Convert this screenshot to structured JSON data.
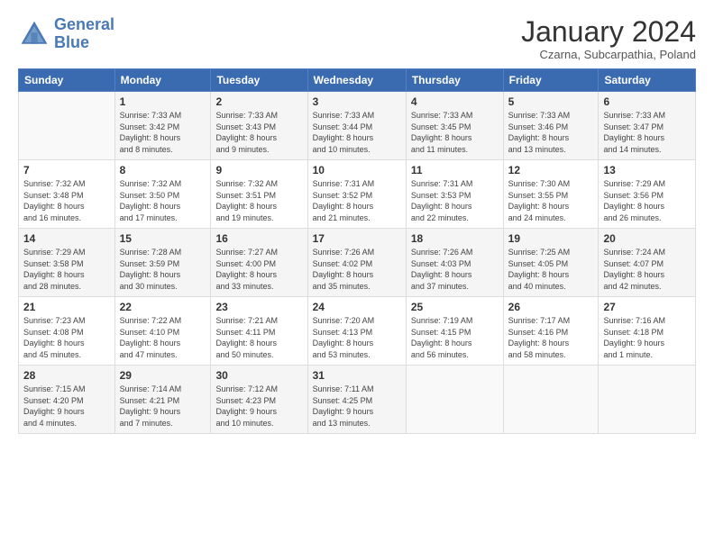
{
  "logo": {
    "line1": "General",
    "line2": "Blue"
  },
  "title": "January 2024",
  "subtitle": "Czarna, Subcarpathia, Poland",
  "days_header": [
    "Sunday",
    "Monday",
    "Tuesday",
    "Wednesday",
    "Thursday",
    "Friday",
    "Saturday"
  ],
  "weeks": [
    [
      {
        "num": "",
        "info": ""
      },
      {
        "num": "1",
        "info": "Sunrise: 7:33 AM\nSunset: 3:42 PM\nDaylight: 8 hours\nand 8 minutes."
      },
      {
        "num": "2",
        "info": "Sunrise: 7:33 AM\nSunset: 3:43 PM\nDaylight: 8 hours\nand 9 minutes."
      },
      {
        "num": "3",
        "info": "Sunrise: 7:33 AM\nSunset: 3:44 PM\nDaylight: 8 hours\nand 10 minutes."
      },
      {
        "num": "4",
        "info": "Sunrise: 7:33 AM\nSunset: 3:45 PM\nDaylight: 8 hours\nand 11 minutes."
      },
      {
        "num": "5",
        "info": "Sunrise: 7:33 AM\nSunset: 3:46 PM\nDaylight: 8 hours\nand 13 minutes."
      },
      {
        "num": "6",
        "info": "Sunrise: 7:33 AM\nSunset: 3:47 PM\nDaylight: 8 hours\nand 14 minutes."
      }
    ],
    [
      {
        "num": "7",
        "info": "Sunrise: 7:32 AM\nSunset: 3:48 PM\nDaylight: 8 hours\nand 16 minutes."
      },
      {
        "num": "8",
        "info": "Sunrise: 7:32 AM\nSunset: 3:50 PM\nDaylight: 8 hours\nand 17 minutes."
      },
      {
        "num": "9",
        "info": "Sunrise: 7:32 AM\nSunset: 3:51 PM\nDaylight: 8 hours\nand 19 minutes."
      },
      {
        "num": "10",
        "info": "Sunrise: 7:31 AM\nSunset: 3:52 PM\nDaylight: 8 hours\nand 21 minutes."
      },
      {
        "num": "11",
        "info": "Sunrise: 7:31 AM\nSunset: 3:53 PM\nDaylight: 8 hours\nand 22 minutes."
      },
      {
        "num": "12",
        "info": "Sunrise: 7:30 AM\nSunset: 3:55 PM\nDaylight: 8 hours\nand 24 minutes."
      },
      {
        "num": "13",
        "info": "Sunrise: 7:29 AM\nSunset: 3:56 PM\nDaylight: 8 hours\nand 26 minutes."
      }
    ],
    [
      {
        "num": "14",
        "info": "Sunrise: 7:29 AM\nSunset: 3:58 PM\nDaylight: 8 hours\nand 28 minutes."
      },
      {
        "num": "15",
        "info": "Sunrise: 7:28 AM\nSunset: 3:59 PM\nDaylight: 8 hours\nand 30 minutes."
      },
      {
        "num": "16",
        "info": "Sunrise: 7:27 AM\nSunset: 4:00 PM\nDaylight: 8 hours\nand 33 minutes."
      },
      {
        "num": "17",
        "info": "Sunrise: 7:26 AM\nSunset: 4:02 PM\nDaylight: 8 hours\nand 35 minutes."
      },
      {
        "num": "18",
        "info": "Sunrise: 7:26 AM\nSunset: 4:03 PM\nDaylight: 8 hours\nand 37 minutes."
      },
      {
        "num": "19",
        "info": "Sunrise: 7:25 AM\nSunset: 4:05 PM\nDaylight: 8 hours\nand 40 minutes."
      },
      {
        "num": "20",
        "info": "Sunrise: 7:24 AM\nSunset: 4:07 PM\nDaylight: 8 hours\nand 42 minutes."
      }
    ],
    [
      {
        "num": "21",
        "info": "Sunrise: 7:23 AM\nSunset: 4:08 PM\nDaylight: 8 hours\nand 45 minutes."
      },
      {
        "num": "22",
        "info": "Sunrise: 7:22 AM\nSunset: 4:10 PM\nDaylight: 8 hours\nand 47 minutes."
      },
      {
        "num": "23",
        "info": "Sunrise: 7:21 AM\nSunset: 4:11 PM\nDaylight: 8 hours\nand 50 minutes."
      },
      {
        "num": "24",
        "info": "Sunrise: 7:20 AM\nSunset: 4:13 PM\nDaylight: 8 hours\nand 53 minutes."
      },
      {
        "num": "25",
        "info": "Sunrise: 7:19 AM\nSunset: 4:15 PM\nDaylight: 8 hours\nand 56 minutes."
      },
      {
        "num": "26",
        "info": "Sunrise: 7:17 AM\nSunset: 4:16 PM\nDaylight: 8 hours\nand 58 minutes."
      },
      {
        "num": "27",
        "info": "Sunrise: 7:16 AM\nSunset: 4:18 PM\nDaylight: 9 hours\nand 1 minute."
      }
    ],
    [
      {
        "num": "28",
        "info": "Sunrise: 7:15 AM\nSunset: 4:20 PM\nDaylight: 9 hours\nand 4 minutes."
      },
      {
        "num": "29",
        "info": "Sunrise: 7:14 AM\nSunset: 4:21 PM\nDaylight: 9 hours\nand 7 minutes."
      },
      {
        "num": "30",
        "info": "Sunrise: 7:12 AM\nSunset: 4:23 PM\nDaylight: 9 hours\nand 10 minutes."
      },
      {
        "num": "31",
        "info": "Sunrise: 7:11 AM\nSunset: 4:25 PM\nDaylight: 9 hours\nand 13 minutes."
      },
      {
        "num": "",
        "info": ""
      },
      {
        "num": "",
        "info": ""
      },
      {
        "num": "",
        "info": ""
      }
    ]
  ]
}
